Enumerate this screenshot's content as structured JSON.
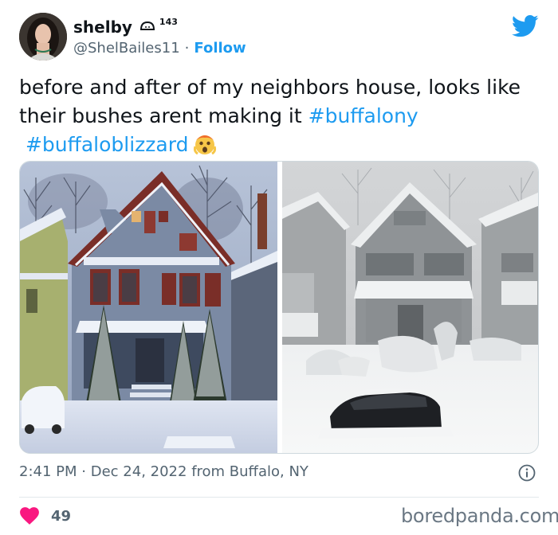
{
  "author": {
    "display_name": "shelby",
    "name_badge_count": "143",
    "handle": "@ShelBailes11",
    "separator": "·",
    "follow_label": "Follow"
  },
  "tweet": {
    "text_line1": "before and after of my neighbors house, looks like",
    "text_line2_prefix": "their bushes arent making it ",
    "hashtag1": "#buffalony",
    "hashtag2": "#buffaloblizzard",
    "emoji": "shocked-face-emoji"
  },
  "media": {
    "left_photo": "before-snowstorm-house-photo",
    "right_photo": "after-blizzard-house-photo"
  },
  "meta": {
    "time": "2:41 PM",
    "separator": "·",
    "date": "Dec 24, 2022",
    "location": "from Buffalo, NY"
  },
  "actions": {
    "like_count": "49"
  },
  "watermark": "boredpanda.com",
  "colors": {
    "accent": "#1d9bf0",
    "like": "#f91880",
    "secondary_text": "#536471"
  }
}
